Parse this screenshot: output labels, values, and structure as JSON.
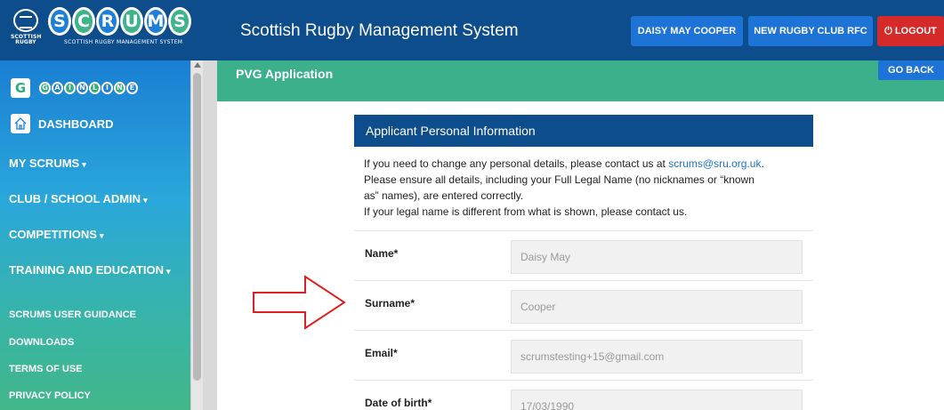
{
  "header": {
    "crest_text": "SCOTTISH RUGBY",
    "logo_letters": [
      "S",
      "C",
      "R",
      "U",
      "M",
      "S"
    ],
    "logo_subtitle": "SCOTTISH RUGBY MANAGEMENT SYSTEM",
    "app_title": "Scottish Rugby Management System",
    "user_button": "DAISY MAY COOPER",
    "club_button": "NEW RUGBY CLUB RFC",
    "logout_button": "LOGOUT",
    "logout_icon": "power-icon"
  },
  "sidebar": {
    "gainline_letters": [
      "G",
      "A",
      "I",
      "N",
      "L",
      "I",
      "N",
      "E"
    ],
    "gainline_badge": "G",
    "dashboard": "DASHBOARD",
    "items": [
      {
        "label": "MY SCRUMS",
        "caret": "▾"
      },
      {
        "label": "CLUB / SCHOOL ADMIN",
        "caret": "▾"
      },
      {
        "label": "COMPETITIONS",
        "caret": "▾"
      },
      {
        "label": "TRAINING AND EDUCATION",
        "caret": "▾"
      }
    ],
    "links": [
      "SCRUMS USER GUIDANCE",
      "DOWNLOADS",
      "TERMS OF USE",
      "PRIVACY POLICY"
    ]
  },
  "content": {
    "page_title": "PVG Application",
    "go_back": "GO BACK",
    "panel_title": "Applicant Personal Information",
    "intro_line1_prefix": "If you need to change any personal details, please contact us at ",
    "intro_email": "scrums@sru.org.uk",
    "intro_line1_suffix": ".",
    "intro_line2": "Please ensure all details, including your Full Legal Name (no nicknames or “known",
    "intro_line3": "as” names), are entered correctly.",
    "intro_line4": "If your legal name is different from what is shown, please contact us.",
    "fields": [
      {
        "label": "Name*",
        "value": "Daisy May"
      },
      {
        "label": "Surname*",
        "value": "Cooper"
      },
      {
        "label": "Email*",
        "value": "scrumstesting+15@gmail.com"
      },
      {
        "label": "Date of birth*",
        "value": "17/03/1990"
      }
    ]
  },
  "colors": {
    "topbar": "#0d4d8c",
    "accent_blue": "#1e73d6",
    "logout_red": "#d42a2a",
    "header_green": "#3bb08a",
    "annotation_red": "#e02020"
  }
}
